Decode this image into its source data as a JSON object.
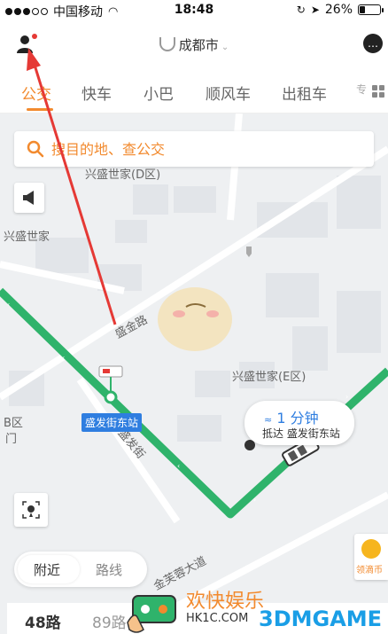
{
  "status_bar": {
    "carrier": "中国移动",
    "time": "18:48",
    "battery": "26%",
    "battery_level": 0.26
  },
  "header": {
    "city": "成都市"
  },
  "tabs": [
    {
      "label": "公交",
      "active": true
    },
    {
      "label": "快车",
      "active": false
    },
    {
      "label": "小巴",
      "active": false
    },
    {
      "label": "顺风车",
      "active": false
    },
    {
      "label": "出租车",
      "active": false
    },
    {
      "label": "专",
      "active": false
    }
  ],
  "search": {
    "placeholder": "搜目的地、查公交"
  },
  "map": {
    "labels": {
      "xingsheng_d": "兴盛世家(D区)",
      "xingsheng": "兴盛世家",
      "shengjin_road": "盛金路",
      "xingsheng_e": "兴盛世家(E区)",
      "b_district": "B区",
      "gate": "门",
      "shengfa_street": "盛发街",
      "jinfurong_avenue": "金芙蓉大道"
    },
    "stop_name": "盛发街东站",
    "eta": {
      "time": "1 分钟",
      "sub_prefix": "抵达",
      "sub_stop": "盛发街东站"
    }
  },
  "bottom_tabs": {
    "nearby": "附近",
    "route": "路线"
  },
  "redpack": {
    "label": "领滴币"
  },
  "routes": [
    "48路",
    "89路"
  ],
  "watermark": {
    "cn": "欢快娱乐",
    "site": "HK1C.COM",
    "brand": "3DMGAME"
  },
  "colors": {
    "accent": "#f28a2e",
    "route_green": "#2fb36b",
    "stop_blue": "#2f7ee0",
    "annotation_red": "#e53935"
  }
}
